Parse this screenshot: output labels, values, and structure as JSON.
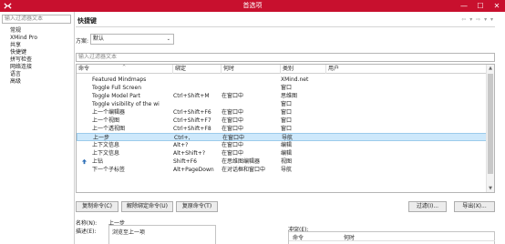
{
  "window": {
    "title": "首选项",
    "minimize": "—",
    "maximize": "☐",
    "close": "✕",
    "brand_color": "#c8102e"
  },
  "sidebar": {
    "filter_placeholder": "输入过滤器文本",
    "items": [
      {
        "label": "常规"
      },
      {
        "label": "XMind Pro"
      },
      {
        "label": "共享"
      },
      {
        "label": "快捷键"
      },
      {
        "label": "拼写检查"
      },
      {
        "label": "网络连接"
      },
      {
        "label": "语言"
      },
      {
        "label": "高级"
      }
    ]
  },
  "page": {
    "title": "快捷键",
    "nav": "⇦ ▾ ⇨ ▾ ▾",
    "scheme_label": "方案:",
    "scheme_value": "默认",
    "filter_placeholder": "输入过滤器文本"
  },
  "table": {
    "columns": [
      "命令",
      "绑定",
      "何时",
      "类别",
      "用户"
    ],
    "sort_indicator": "^",
    "rows": [
      {
        "command": "Featured Mindmaps",
        "binding": "",
        "when": "",
        "category": "XMind.net",
        "icon": ""
      },
      {
        "command": "Toggle Full Screen",
        "binding": "",
        "when": "",
        "category": "窗口",
        "icon": ""
      },
      {
        "command": "Toggle Model Part",
        "binding": "Ctrl+Shift+M",
        "when": "在窗口中",
        "category": "思维图",
        "icon": ""
      },
      {
        "command": "Toggle visibility of the wi",
        "binding": "",
        "when": "",
        "category": "窗口",
        "icon": ""
      },
      {
        "command": "上一个编辑器",
        "binding": "Ctrl+Shift+F6",
        "when": "在窗口中",
        "category": "窗口",
        "icon": ""
      },
      {
        "command": "上一个视图",
        "binding": "Ctrl+Shift+F7",
        "when": "在窗口中",
        "category": "窗口",
        "icon": ""
      },
      {
        "command": "上一个透视图",
        "binding": "Ctrl+Shift+F8",
        "when": "在窗口中",
        "category": "窗口",
        "icon": ""
      },
      {
        "command": "上一步",
        "binding": "Ctrl+,",
        "when": "在窗口中",
        "category": "导航",
        "icon": "",
        "selected": true
      },
      {
        "command": "上下文信息",
        "binding": "Alt+?",
        "when": "在窗口中",
        "category": "编辑",
        "icon": ""
      },
      {
        "command": "上下文信息",
        "binding": "Alt+Shift+?",
        "when": "在窗口中",
        "category": "编辑",
        "icon": ""
      },
      {
        "command": "上钻",
        "binding": "Shift+F6",
        "when": "在思维图编辑器",
        "category": "视图",
        "icon": "drill-up-icon"
      },
      {
        "command": "下一个子标签",
        "binding": "Alt+PageDown",
        "when": "在对话框和窗口中",
        "category": "导航",
        "icon": ""
      }
    ]
  },
  "buttons": {
    "copy": "复制命令(C)",
    "unbind": "解除绑定命令(U)",
    "restore": "复原命令(T)",
    "filter": "过滤(I)...",
    "export": "导出(X)..."
  },
  "details": {
    "name_label": "名称(N):",
    "name_value": "上一步",
    "desc_label": "描述(E):",
    "desc_value": "浏览至上一项",
    "conflict_label": "冲突(E):",
    "conflict_col_command": "命令",
    "conflict_col_when": "何时"
  }
}
